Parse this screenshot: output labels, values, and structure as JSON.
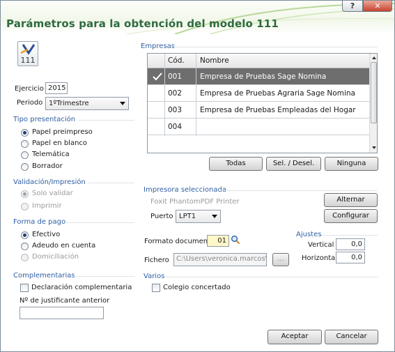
{
  "window": {
    "title": "Parámetros para la obtención del modelo 111",
    "help_label": "?",
    "close_label": "✕",
    "logo_text": "111"
  },
  "left": {
    "ejercicio_label": "Ejercicio",
    "ejercicio_value": "2015",
    "periodo_label": "Periodo",
    "periodo_value": "1ºTrimestre",
    "tipo_presentacion": {
      "title": "Tipo presentación",
      "options": [
        "Papel preimpreso",
        "Papel en blanco",
        "Telemática",
        "Borrador"
      ],
      "selected": "Papel preimpreso"
    },
    "validacion": {
      "title": "Validación/Impresión",
      "options": [
        "Solo validar",
        "Imprimir"
      ],
      "selected": "Solo validar"
    },
    "forma_pago": {
      "title": "Forma de pago",
      "options": [
        "Efectivo",
        "Adeudo en cuenta",
        "Domiciliación"
      ],
      "selected": "Efectivo"
    },
    "complementarias": {
      "title": "Complementarias",
      "checkbox_label": "Declaración complementaria",
      "justificante_label": "Nº de justificante anterior",
      "justificante_value": ""
    }
  },
  "empresas": {
    "title": "Empresas",
    "columns": [
      "Cód.",
      "Nombre"
    ],
    "rows": [
      {
        "codigo": "001",
        "nombre": "Empresa de Pruebas Sage Nomina",
        "selected": true
      },
      {
        "codigo": "002",
        "nombre": "Empresa de Pruebas Agraria Sage Nomina",
        "selected": false
      },
      {
        "codigo": "003",
        "nombre": "Empresa de Pruebas Empleadas del Hogar",
        "selected": false
      },
      {
        "codigo": "004",
        "nombre": "",
        "selected": false
      }
    ],
    "buttons": {
      "todas": "Todas",
      "sel_desel": "Sel. / Desel.",
      "ninguna": "Ninguna"
    }
  },
  "impresora": {
    "title": "Impresora seleccionada",
    "printer_name": "Foxit PhantomPDF Printer",
    "alternar_label": "Alternar",
    "puerto_label": "Puerto",
    "puerto_value": "LPT1",
    "configurar_label": "Configurar"
  },
  "formato": {
    "label": "Formato documento",
    "value": "01",
    "fichero_label": "Fichero",
    "fichero_value": "C:\\Users\\veronica.marcos\\Do",
    "browse_label": "..."
  },
  "ajustes": {
    "title": "Ajustes",
    "vertical_label": "Vertical",
    "vertical_value": "0,0",
    "horizontal_label": "Horizontal",
    "horizontal_value": "0,0"
  },
  "varios": {
    "title": "Varios",
    "checkbox_label": "Colegio concertado"
  },
  "footer": {
    "aceptar_label": "Aceptar",
    "cancelar_label": "Cancelar"
  },
  "colors": {
    "title_green": "#2e6b3e",
    "section_blue": "#2f5fa3",
    "selected_row": "#6e6e6e"
  }
}
